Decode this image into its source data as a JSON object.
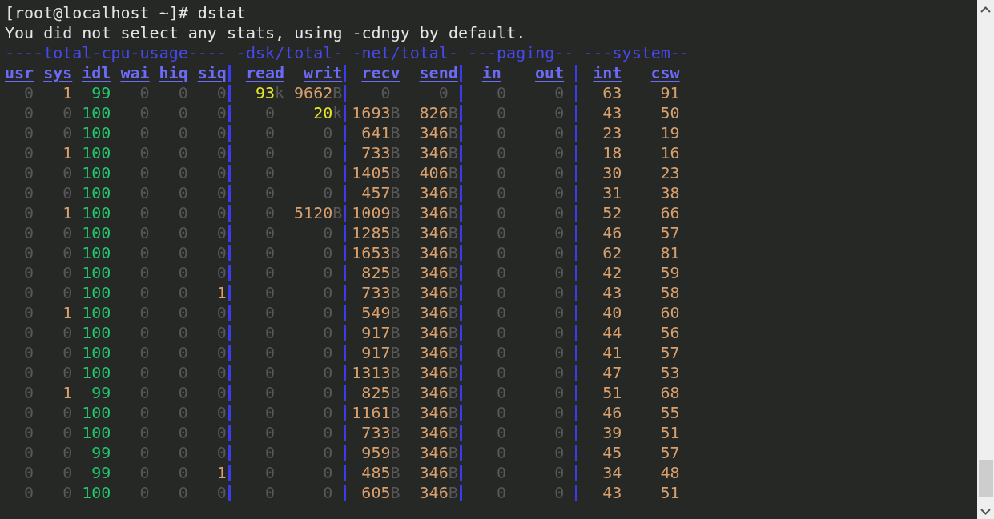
{
  "prompt": "[root@localhost ~]# dstat",
  "message": "You did not select any stats, using -cdngy by default.",
  "groups": [
    {
      "title": "----total-cpu-usage----",
      "columns": [
        "usr",
        "sys",
        "idl",
        "wai",
        "hiq",
        "siq"
      ]
    },
    {
      "title": "-dsk/total-",
      "columns": [
        "read",
        "writ"
      ]
    },
    {
      "title": "-net/total-",
      "columns": [
        "recv",
        "send"
      ]
    },
    {
      "title": "---paging--",
      "columns": [
        "in",
        "out"
      ]
    },
    {
      "title": "---system--",
      "columns": [
        "int",
        "csw"
      ]
    }
  ],
  "rows": [
    [
      [
        {
          "value": "0",
          "kind": "zero"
        },
        {
          "value": "1",
          "kind": "low"
        },
        {
          "value": "99",
          "kind": "full"
        },
        {
          "value": "0",
          "kind": "zero"
        },
        {
          "value": "0",
          "kind": "zero"
        },
        {
          "value": "0",
          "kind": "zero"
        }
      ],
      [
        {
          "value": "93",
          "unit": "k",
          "kind": "kilo"
        },
        {
          "value": "9662",
          "unit": "B",
          "kind": "low"
        }
      ],
      [
        {
          "value": "0",
          "kind": "zero"
        },
        {
          "value": "0",
          "kind": "zero"
        }
      ],
      [
        {
          "value": "0",
          "kind": "zero"
        },
        {
          "value": "0",
          "kind": "zero"
        }
      ],
      [
        {
          "value": "63",
          "kind": "low"
        },
        {
          "value": "91",
          "kind": "low"
        }
      ]
    ],
    [
      [
        {
          "value": "0",
          "kind": "zero"
        },
        {
          "value": "0",
          "kind": "zero"
        },
        {
          "value": "100",
          "kind": "full"
        },
        {
          "value": "0",
          "kind": "zero"
        },
        {
          "value": "0",
          "kind": "zero"
        },
        {
          "value": "0",
          "kind": "zero"
        }
      ],
      [
        {
          "value": "0",
          "kind": "zero"
        },
        {
          "value": "20",
          "unit": "k",
          "kind": "kilo"
        }
      ],
      [
        {
          "value": "1693",
          "unit": "B",
          "kind": "low"
        },
        {
          "value": "826",
          "unit": "B",
          "kind": "low"
        }
      ],
      [
        {
          "value": "0",
          "kind": "zero"
        },
        {
          "value": "0",
          "kind": "zero"
        }
      ],
      [
        {
          "value": "43",
          "kind": "low"
        },
        {
          "value": "50",
          "kind": "low"
        }
      ]
    ],
    [
      [
        {
          "value": "0",
          "kind": "zero"
        },
        {
          "value": "0",
          "kind": "zero"
        },
        {
          "value": "100",
          "kind": "full"
        },
        {
          "value": "0",
          "kind": "zero"
        },
        {
          "value": "0",
          "kind": "zero"
        },
        {
          "value": "0",
          "kind": "zero"
        }
      ],
      [
        {
          "value": "0",
          "kind": "zero"
        },
        {
          "value": "0",
          "kind": "zero"
        }
      ],
      [
        {
          "value": "641",
          "unit": "B",
          "kind": "low"
        },
        {
          "value": "346",
          "unit": "B",
          "kind": "low"
        }
      ],
      [
        {
          "value": "0",
          "kind": "zero"
        },
        {
          "value": "0",
          "kind": "zero"
        }
      ],
      [
        {
          "value": "23",
          "kind": "low"
        },
        {
          "value": "19",
          "kind": "low"
        }
      ]
    ],
    [
      [
        {
          "value": "0",
          "kind": "zero"
        },
        {
          "value": "1",
          "kind": "low"
        },
        {
          "value": "100",
          "kind": "full"
        },
        {
          "value": "0",
          "kind": "zero"
        },
        {
          "value": "0",
          "kind": "zero"
        },
        {
          "value": "0",
          "kind": "zero"
        }
      ],
      [
        {
          "value": "0",
          "kind": "zero"
        },
        {
          "value": "0",
          "kind": "zero"
        }
      ],
      [
        {
          "value": "733",
          "unit": "B",
          "kind": "low"
        },
        {
          "value": "346",
          "unit": "B",
          "kind": "low"
        }
      ],
      [
        {
          "value": "0",
          "kind": "zero"
        },
        {
          "value": "0",
          "kind": "zero"
        }
      ],
      [
        {
          "value": "18",
          "kind": "low"
        },
        {
          "value": "16",
          "kind": "low"
        }
      ]
    ],
    [
      [
        {
          "value": "0",
          "kind": "zero"
        },
        {
          "value": "0",
          "kind": "zero"
        },
        {
          "value": "100",
          "kind": "full"
        },
        {
          "value": "0",
          "kind": "zero"
        },
        {
          "value": "0",
          "kind": "zero"
        },
        {
          "value": "0",
          "kind": "zero"
        }
      ],
      [
        {
          "value": "0",
          "kind": "zero"
        },
        {
          "value": "0",
          "kind": "zero"
        }
      ],
      [
        {
          "value": "1405",
          "unit": "B",
          "kind": "low"
        },
        {
          "value": "406",
          "unit": "B",
          "kind": "low"
        }
      ],
      [
        {
          "value": "0",
          "kind": "zero"
        },
        {
          "value": "0",
          "kind": "zero"
        }
      ],
      [
        {
          "value": "30",
          "kind": "low"
        },
        {
          "value": "23",
          "kind": "low"
        }
      ]
    ],
    [
      [
        {
          "value": "0",
          "kind": "zero"
        },
        {
          "value": "0",
          "kind": "zero"
        },
        {
          "value": "100",
          "kind": "full"
        },
        {
          "value": "0",
          "kind": "zero"
        },
        {
          "value": "0",
          "kind": "zero"
        },
        {
          "value": "0",
          "kind": "zero"
        }
      ],
      [
        {
          "value": "0",
          "kind": "zero"
        },
        {
          "value": "0",
          "kind": "zero"
        }
      ],
      [
        {
          "value": "457",
          "unit": "B",
          "kind": "low"
        },
        {
          "value": "346",
          "unit": "B",
          "kind": "low"
        }
      ],
      [
        {
          "value": "0",
          "kind": "zero"
        },
        {
          "value": "0",
          "kind": "zero"
        }
      ],
      [
        {
          "value": "31",
          "kind": "low"
        },
        {
          "value": "38",
          "kind": "low"
        }
      ]
    ],
    [
      [
        {
          "value": "0",
          "kind": "zero"
        },
        {
          "value": "1",
          "kind": "low"
        },
        {
          "value": "100",
          "kind": "full"
        },
        {
          "value": "0",
          "kind": "zero"
        },
        {
          "value": "0",
          "kind": "zero"
        },
        {
          "value": "0",
          "kind": "zero"
        }
      ],
      [
        {
          "value": "0",
          "kind": "zero"
        },
        {
          "value": "5120",
          "unit": "B",
          "kind": "low"
        }
      ],
      [
        {
          "value": "1009",
          "unit": "B",
          "kind": "low"
        },
        {
          "value": "346",
          "unit": "B",
          "kind": "low"
        }
      ],
      [
        {
          "value": "0",
          "kind": "zero"
        },
        {
          "value": "0",
          "kind": "zero"
        }
      ],
      [
        {
          "value": "52",
          "kind": "low"
        },
        {
          "value": "66",
          "kind": "low"
        }
      ]
    ],
    [
      [
        {
          "value": "0",
          "kind": "zero"
        },
        {
          "value": "0",
          "kind": "zero"
        },
        {
          "value": "100",
          "kind": "full"
        },
        {
          "value": "0",
          "kind": "zero"
        },
        {
          "value": "0",
          "kind": "zero"
        },
        {
          "value": "0",
          "kind": "zero"
        }
      ],
      [
        {
          "value": "0",
          "kind": "zero"
        },
        {
          "value": "0",
          "kind": "zero"
        }
      ],
      [
        {
          "value": "1285",
          "unit": "B",
          "kind": "low"
        },
        {
          "value": "346",
          "unit": "B",
          "kind": "low"
        }
      ],
      [
        {
          "value": "0",
          "kind": "zero"
        },
        {
          "value": "0",
          "kind": "zero"
        }
      ],
      [
        {
          "value": "46",
          "kind": "low"
        },
        {
          "value": "57",
          "kind": "low"
        }
      ]
    ],
    [
      [
        {
          "value": "0",
          "kind": "zero"
        },
        {
          "value": "0",
          "kind": "zero"
        },
        {
          "value": "100",
          "kind": "full"
        },
        {
          "value": "0",
          "kind": "zero"
        },
        {
          "value": "0",
          "kind": "zero"
        },
        {
          "value": "0",
          "kind": "zero"
        }
      ],
      [
        {
          "value": "0",
          "kind": "zero"
        },
        {
          "value": "0",
          "kind": "zero"
        }
      ],
      [
        {
          "value": "1653",
          "unit": "B",
          "kind": "low"
        },
        {
          "value": "346",
          "unit": "B",
          "kind": "low"
        }
      ],
      [
        {
          "value": "0",
          "kind": "zero"
        },
        {
          "value": "0",
          "kind": "zero"
        }
      ],
      [
        {
          "value": "62",
          "kind": "low"
        },
        {
          "value": "81",
          "kind": "low"
        }
      ]
    ],
    [
      [
        {
          "value": "0",
          "kind": "zero"
        },
        {
          "value": "0",
          "kind": "zero"
        },
        {
          "value": "100",
          "kind": "full"
        },
        {
          "value": "0",
          "kind": "zero"
        },
        {
          "value": "0",
          "kind": "zero"
        },
        {
          "value": "0",
          "kind": "zero"
        }
      ],
      [
        {
          "value": "0",
          "kind": "zero"
        },
        {
          "value": "0",
          "kind": "zero"
        }
      ],
      [
        {
          "value": "825",
          "unit": "B",
          "kind": "low"
        },
        {
          "value": "346",
          "unit": "B",
          "kind": "low"
        }
      ],
      [
        {
          "value": "0",
          "kind": "zero"
        },
        {
          "value": "0",
          "kind": "zero"
        }
      ],
      [
        {
          "value": "42",
          "kind": "low"
        },
        {
          "value": "59",
          "kind": "low"
        }
      ]
    ],
    [
      [
        {
          "value": "0",
          "kind": "zero"
        },
        {
          "value": "0",
          "kind": "zero"
        },
        {
          "value": "100",
          "kind": "full"
        },
        {
          "value": "0",
          "kind": "zero"
        },
        {
          "value": "0",
          "kind": "zero"
        },
        {
          "value": "1",
          "kind": "low"
        }
      ],
      [
        {
          "value": "0",
          "kind": "zero"
        },
        {
          "value": "0",
          "kind": "zero"
        }
      ],
      [
        {
          "value": "733",
          "unit": "B",
          "kind": "low"
        },
        {
          "value": "346",
          "unit": "B",
          "kind": "low"
        }
      ],
      [
        {
          "value": "0",
          "kind": "zero"
        },
        {
          "value": "0",
          "kind": "zero"
        }
      ],
      [
        {
          "value": "43",
          "kind": "low"
        },
        {
          "value": "58",
          "kind": "low"
        }
      ]
    ],
    [
      [
        {
          "value": "0",
          "kind": "zero"
        },
        {
          "value": "1",
          "kind": "low"
        },
        {
          "value": "100",
          "kind": "full"
        },
        {
          "value": "0",
          "kind": "zero"
        },
        {
          "value": "0",
          "kind": "zero"
        },
        {
          "value": "0",
          "kind": "zero"
        }
      ],
      [
        {
          "value": "0",
          "kind": "zero"
        },
        {
          "value": "0",
          "kind": "zero"
        }
      ],
      [
        {
          "value": "549",
          "unit": "B",
          "kind": "low"
        },
        {
          "value": "346",
          "unit": "B",
          "kind": "low"
        }
      ],
      [
        {
          "value": "0",
          "kind": "zero"
        },
        {
          "value": "0",
          "kind": "zero"
        }
      ],
      [
        {
          "value": "40",
          "kind": "low"
        },
        {
          "value": "60",
          "kind": "low"
        }
      ]
    ],
    [
      [
        {
          "value": "0",
          "kind": "zero"
        },
        {
          "value": "0",
          "kind": "zero"
        },
        {
          "value": "100",
          "kind": "full"
        },
        {
          "value": "0",
          "kind": "zero"
        },
        {
          "value": "0",
          "kind": "zero"
        },
        {
          "value": "0",
          "kind": "zero"
        }
      ],
      [
        {
          "value": "0",
          "kind": "zero"
        },
        {
          "value": "0",
          "kind": "zero"
        }
      ],
      [
        {
          "value": "917",
          "unit": "B",
          "kind": "low"
        },
        {
          "value": "346",
          "unit": "B",
          "kind": "low"
        }
      ],
      [
        {
          "value": "0",
          "kind": "zero"
        },
        {
          "value": "0",
          "kind": "zero"
        }
      ],
      [
        {
          "value": "44",
          "kind": "low"
        },
        {
          "value": "56",
          "kind": "low"
        }
      ]
    ],
    [
      [
        {
          "value": "0",
          "kind": "zero"
        },
        {
          "value": "0",
          "kind": "zero"
        },
        {
          "value": "100",
          "kind": "full"
        },
        {
          "value": "0",
          "kind": "zero"
        },
        {
          "value": "0",
          "kind": "zero"
        },
        {
          "value": "0",
          "kind": "zero"
        }
      ],
      [
        {
          "value": "0",
          "kind": "zero"
        },
        {
          "value": "0",
          "kind": "zero"
        }
      ],
      [
        {
          "value": "917",
          "unit": "B",
          "kind": "low"
        },
        {
          "value": "346",
          "unit": "B",
          "kind": "low"
        }
      ],
      [
        {
          "value": "0",
          "kind": "zero"
        },
        {
          "value": "0",
          "kind": "zero"
        }
      ],
      [
        {
          "value": "41",
          "kind": "low"
        },
        {
          "value": "57",
          "kind": "low"
        }
      ]
    ],
    [
      [
        {
          "value": "0",
          "kind": "zero"
        },
        {
          "value": "0",
          "kind": "zero"
        },
        {
          "value": "100",
          "kind": "full"
        },
        {
          "value": "0",
          "kind": "zero"
        },
        {
          "value": "0",
          "kind": "zero"
        },
        {
          "value": "0",
          "kind": "zero"
        }
      ],
      [
        {
          "value": "0",
          "kind": "zero"
        },
        {
          "value": "0",
          "kind": "zero"
        }
      ],
      [
        {
          "value": "1313",
          "unit": "B",
          "kind": "low"
        },
        {
          "value": "346",
          "unit": "B",
          "kind": "low"
        }
      ],
      [
        {
          "value": "0",
          "kind": "zero"
        },
        {
          "value": "0",
          "kind": "zero"
        }
      ],
      [
        {
          "value": "47",
          "kind": "low"
        },
        {
          "value": "53",
          "kind": "low"
        }
      ]
    ],
    [
      [
        {
          "value": "0",
          "kind": "zero"
        },
        {
          "value": "1",
          "kind": "low"
        },
        {
          "value": "99",
          "kind": "full"
        },
        {
          "value": "0",
          "kind": "zero"
        },
        {
          "value": "0",
          "kind": "zero"
        },
        {
          "value": "0",
          "kind": "zero"
        }
      ],
      [
        {
          "value": "0",
          "kind": "zero"
        },
        {
          "value": "0",
          "kind": "zero"
        }
      ],
      [
        {
          "value": "825",
          "unit": "B",
          "kind": "low"
        },
        {
          "value": "346",
          "unit": "B",
          "kind": "low"
        }
      ],
      [
        {
          "value": "0",
          "kind": "zero"
        },
        {
          "value": "0",
          "kind": "zero"
        }
      ],
      [
        {
          "value": "51",
          "kind": "low"
        },
        {
          "value": "68",
          "kind": "low"
        }
      ]
    ],
    [
      [
        {
          "value": "0",
          "kind": "zero"
        },
        {
          "value": "0",
          "kind": "zero"
        },
        {
          "value": "100",
          "kind": "full"
        },
        {
          "value": "0",
          "kind": "zero"
        },
        {
          "value": "0",
          "kind": "zero"
        },
        {
          "value": "0",
          "kind": "zero"
        }
      ],
      [
        {
          "value": "0",
          "kind": "zero"
        },
        {
          "value": "0",
          "kind": "zero"
        }
      ],
      [
        {
          "value": "1161",
          "unit": "B",
          "kind": "low"
        },
        {
          "value": "346",
          "unit": "B",
          "kind": "low"
        }
      ],
      [
        {
          "value": "0",
          "kind": "zero"
        },
        {
          "value": "0",
          "kind": "zero"
        }
      ],
      [
        {
          "value": "46",
          "kind": "low"
        },
        {
          "value": "55",
          "kind": "low"
        }
      ]
    ],
    [
      [
        {
          "value": "0",
          "kind": "zero"
        },
        {
          "value": "0",
          "kind": "zero"
        },
        {
          "value": "100",
          "kind": "full"
        },
        {
          "value": "0",
          "kind": "zero"
        },
        {
          "value": "0",
          "kind": "zero"
        },
        {
          "value": "0",
          "kind": "zero"
        }
      ],
      [
        {
          "value": "0",
          "kind": "zero"
        },
        {
          "value": "0",
          "kind": "zero"
        }
      ],
      [
        {
          "value": "733",
          "unit": "B",
          "kind": "low"
        },
        {
          "value": "346",
          "unit": "B",
          "kind": "low"
        }
      ],
      [
        {
          "value": "0",
          "kind": "zero"
        },
        {
          "value": "0",
          "kind": "zero"
        }
      ],
      [
        {
          "value": "39",
          "kind": "low"
        },
        {
          "value": "51",
          "kind": "low"
        }
      ]
    ],
    [
      [
        {
          "value": "0",
          "kind": "zero"
        },
        {
          "value": "0",
          "kind": "zero"
        },
        {
          "value": "99",
          "kind": "full"
        },
        {
          "value": "0",
          "kind": "zero"
        },
        {
          "value": "0",
          "kind": "zero"
        },
        {
          "value": "0",
          "kind": "zero"
        }
      ],
      [
        {
          "value": "0",
          "kind": "zero"
        },
        {
          "value": "0",
          "kind": "zero"
        }
      ],
      [
        {
          "value": "959",
          "unit": "B",
          "kind": "low"
        },
        {
          "value": "346",
          "unit": "B",
          "kind": "low"
        }
      ],
      [
        {
          "value": "0",
          "kind": "zero"
        },
        {
          "value": "0",
          "kind": "zero"
        }
      ],
      [
        {
          "value": "45",
          "kind": "low"
        },
        {
          "value": "57",
          "kind": "low"
        }
      ]
    ],
    [
      [
        {
          "value": "0",
          "kind": "zero"
        },
        {
          "value": "0",
          "kind": "zero"
        },
        {
          "value": "99",
          "kind": "full"
        },
        {
          "value": "0",
          "kind": "zero"
        },
        {
          "value": "0",
          "kind": "zero"
        },
        {
          "value": "1",
          "kind": "low"
        }
      ],
      [
        {
          "value": "0",
          "kind": "zero"
        },
        {
          "value": "0",
          "kind": "zero"
        }
      ],
      [
        {
          "value": "485",
          "unit": "B",
          "kind": "low"
        },
        {
          "value": "346",
          "unit": "B",
          "kind": "low"
        }
      ],
      [
        {
          "value": "0",
          "kind": "zero"
        },
        {
          "value": "0",
          "kind": "zero"
        }
      ],
      [
        {
          "value": "34",
          "kind": "low"
        },
        {
          "value": "48",
          "kind": "low"
        }
      ]
    ],
    [
      [
        {
          "value": "0",
          "kind": "zero"
        },
        {
          "value": "0",
          "kind": "zero"
        },
        {
          "value": "100",
          "kind": "full"
        },
        {
          "value": "0",
          "kind": "zero"
        },
        {
          "value": "0",
          "kind": "zero"
        },
        {
          "value": "0",
          "kind": "zero"
        }
      ],
      [
        {
          "value": "0",
          "kind": "zero"
        },
        {
          "value": "0",
          "kind": "zero"
        }
      ],
      [
        {
          "value": "605",
          "unit": "B",
          "kind": "low"
        },
        {
          "value": "346",
          "unit": "B",
          "kind": "low"
        }
      ],
      [
        {
          "value": "0",
          "kind": "zero"
        },
        {
          "value": "0",
          "kind": "zero"
        }
      ],
      [
        {
          "value": "43",
          "kind": "low"
        },
        {
          "value": "51",
          "kind": "low"
        }
      ]
    ]
  ]
}
